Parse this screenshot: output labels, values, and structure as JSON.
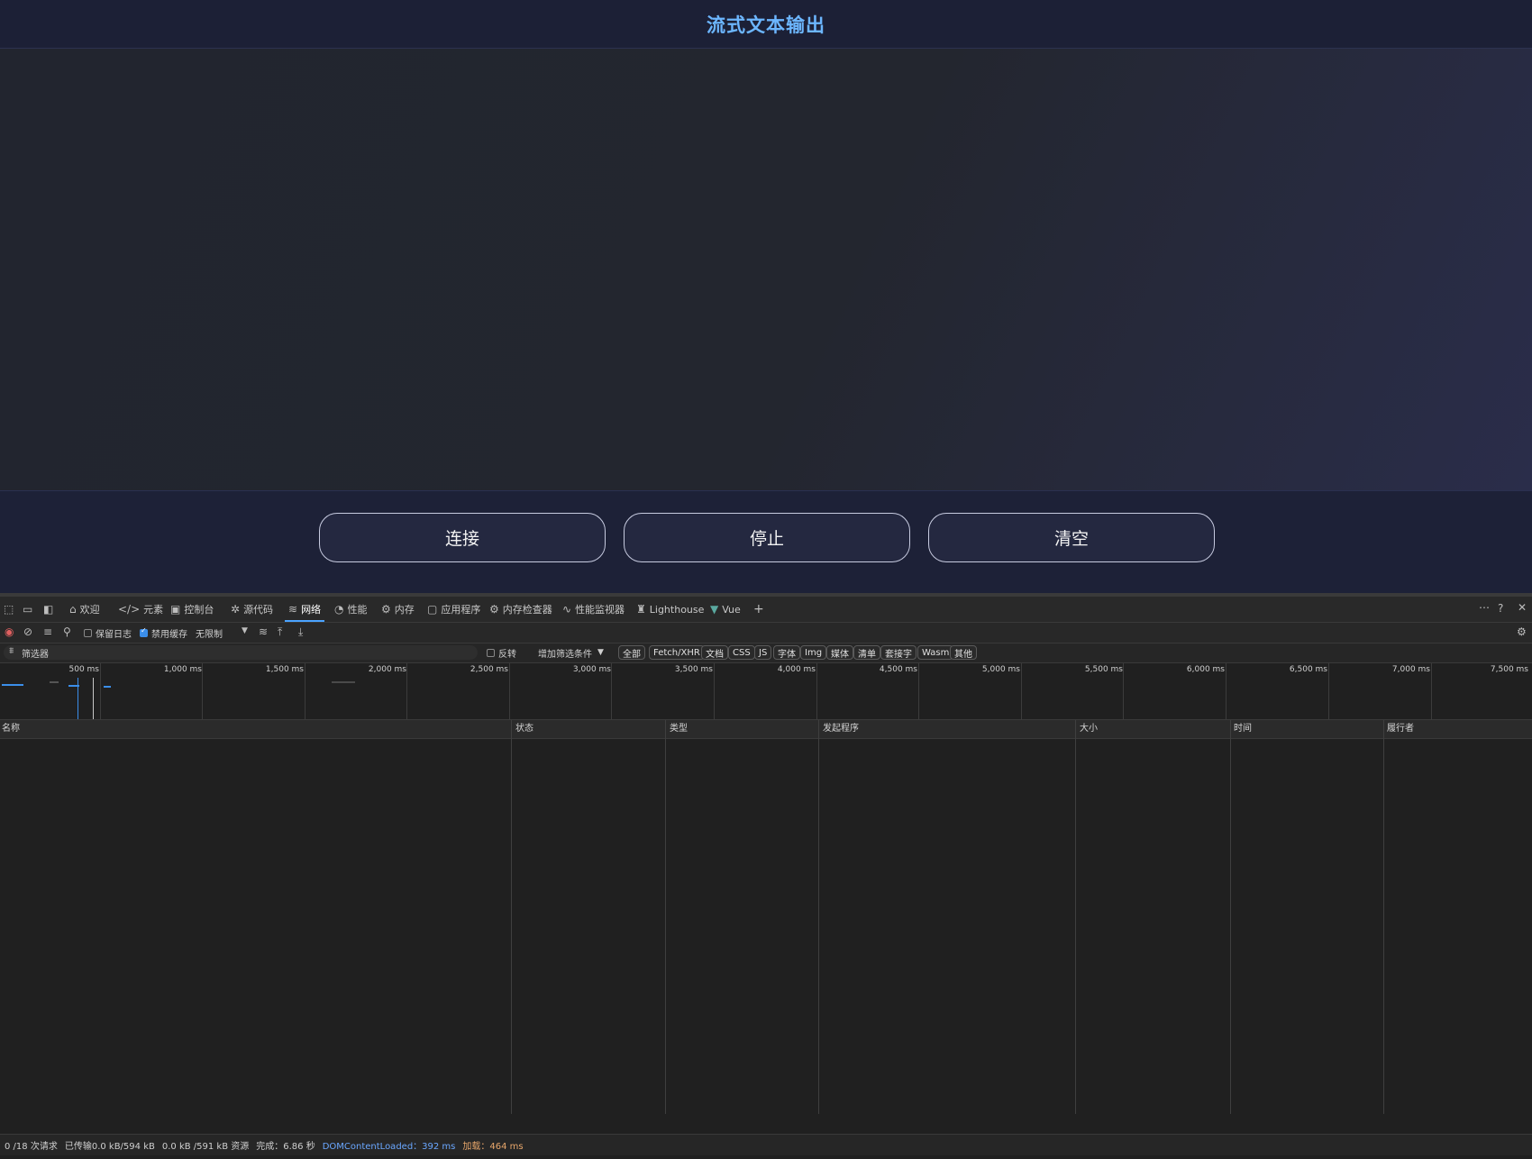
{
  "app": {
    "title": "流式文本输出",
    "buttons": {
      "connect": "连接",
      "stop": "停止",
      "clear": "清空"
    }
  },
  "devtools": {
    "tabs": [
      "欢迎",
      "元素",
      "控制台",
      "源代码",
      "网络",
      "性能",
      "内存",
      "应用程序",
      "内存检查器",
      "性能监视器",
      "Lighthouse",
      "Vue"
    ],
    "active_tab": "网络",
    "toolbar": {
      "preserve_log": "保留日志",
      "disable_cache": "禁用缓存",
      "throttling": "无限制"
    },
    "filter": {
      "placeholder": "筛选器",
      "invert": "反转",
      "more_filters": "增加筛选条件",
      "types": [
        "全部",
        "Fetch/XHR",
        "文档",
        "CSS",
        "JS",
        "字体",
        "Img",
        "媒体",
        "清单",
        "套接字",
        "Wasm",
        "其他"
      ]
    },
    "timeline_ticks": [
      "500 ms",
      "1,000 ms",
      "1,500 ms",
      "2,000 ms",
      "2,500 ms",
      "3,000 ms",
      "3,500 ms",
      "4,000 ms",
      "4,500 ms",
      "5,000 ms",
      "5,500 ms",
      "6,000 ms",
      "6,500 ms",
      "7,000 ms",
      "7,500 ms"
    ],
    "columns": [
      "名称",
      "状态",
      "类型",
      "发起程序",
      "大小",
      "时间",
      "履行者"
    ],
    "status": {
      "requests": "0 /18 次请求",
      "transferred": "已传输0.0 kB/594 kB",
      "resources": "0.0 kB /591 kB 资源",
      "finish": "完成：6.86 秒",
      "dcl": "DOMContentLoaded：392 ms",
      "load": "加载：464 ms"
    }
  }
}
